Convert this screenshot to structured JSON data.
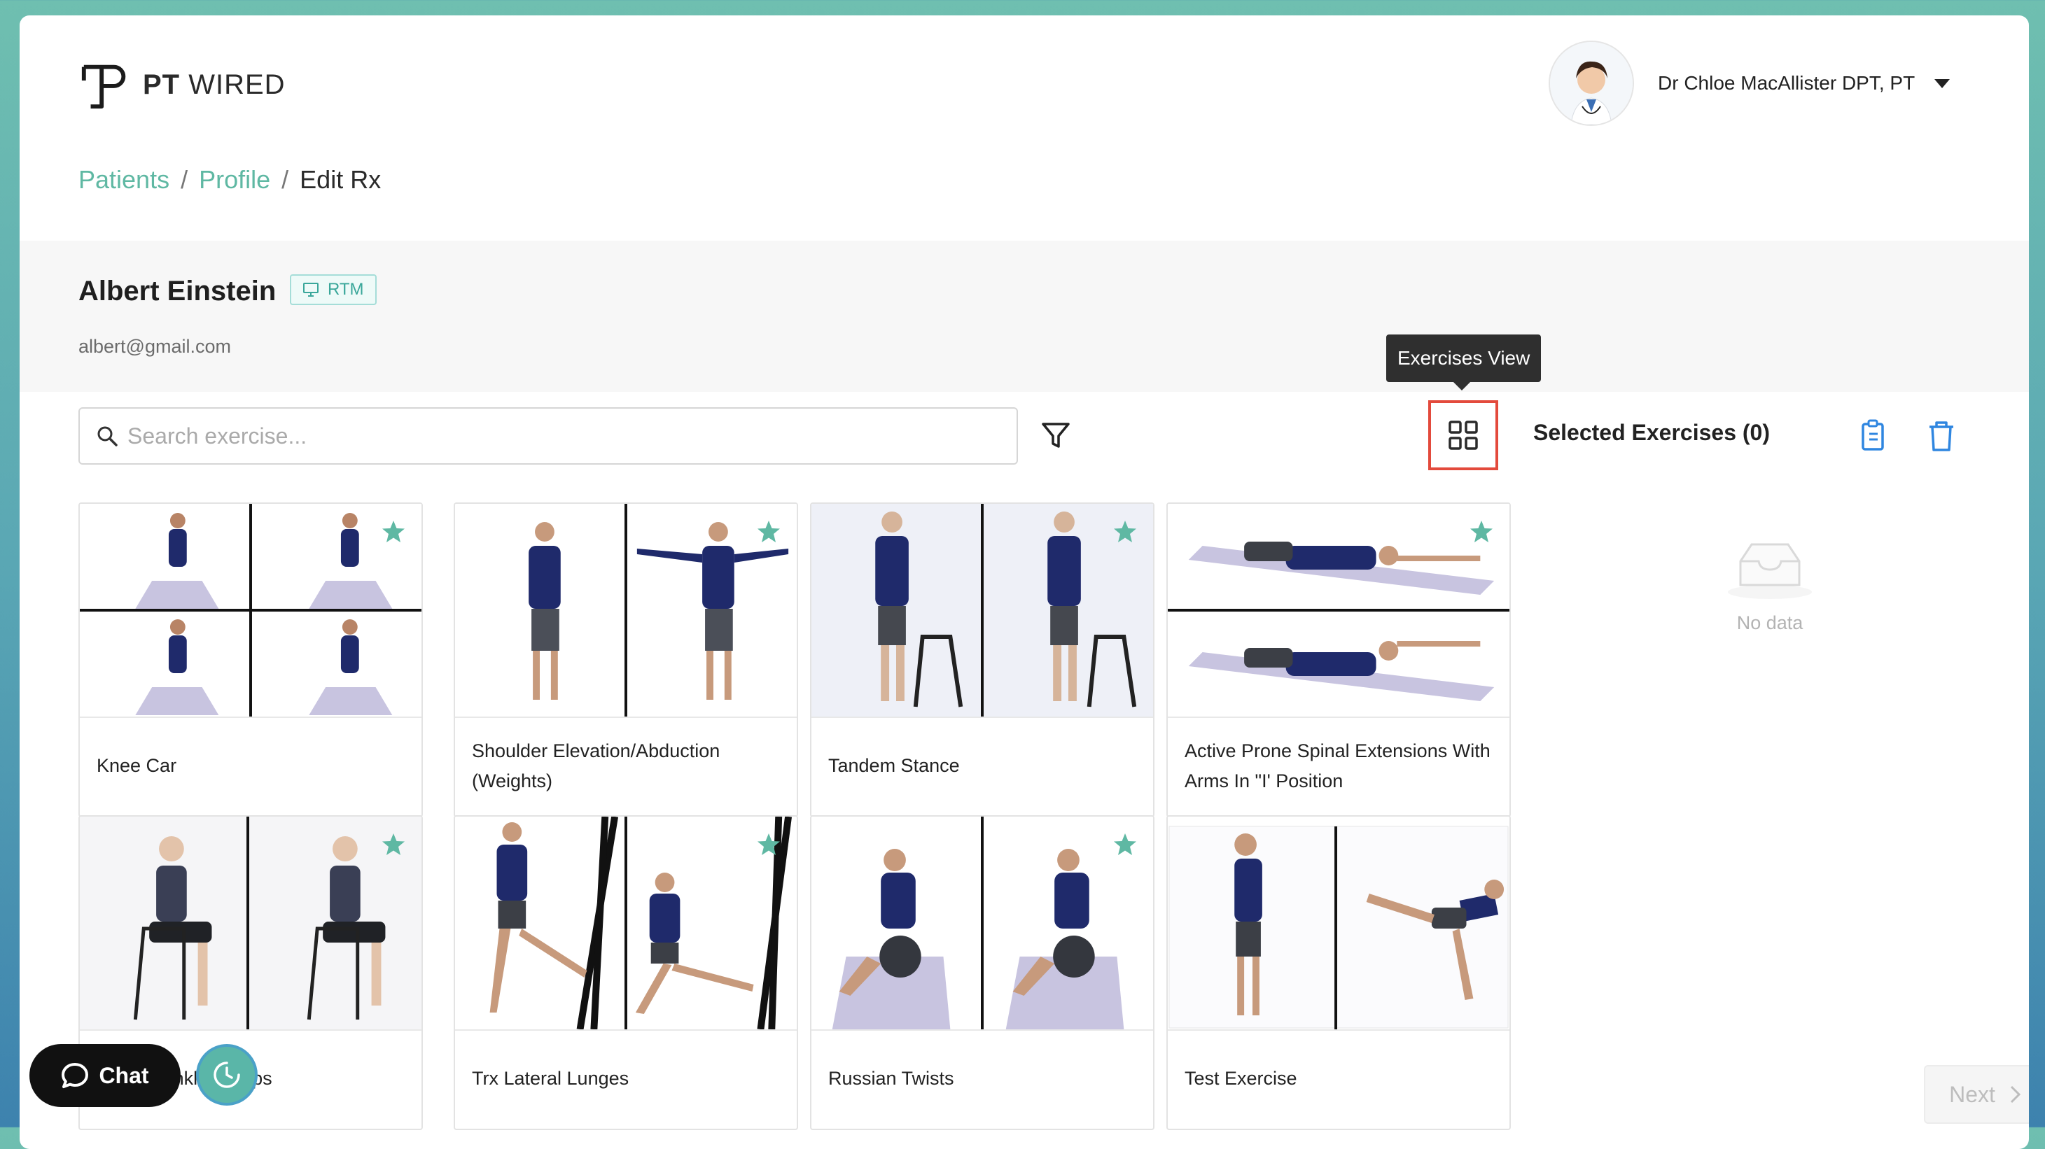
{
  "brand": {
    "name_bold": "PT",
    "name_rest": "WIRED"
  },
  "user": {
    "name": "Dr Chloe MacAllister DPT, PT"
  },
  "breadcrumb": {
    "items": [
      "Patients",
      "Profile"
    ],
    "separator": "/",
    "current": "Edit Rx"
  },
  "patient": {
    "name": "Albert Einstein",
    "badge": "RTM",
    "email": "albert@gmail.com"
  },
  "search": {
    "placeholder": "Search exercise..."
  },
  "toolbar": {
    "tooltip": "Exercises View"
  },
  "selected": {
    "title": "Selected Exercises (0)",
    "empty_text": "No data"
  },
  "exercises": [
    {
      "title": "Knee Car",
      "favorite": true
    },
    {
      "title": "Shoulder Elevation/Abduction (Weights)",
      "favorite": true
    },
    {
      "title": "Tandem Stance",
      "favorite": true
    },
    {
      "title": "Active Prone Spinal Extensions With Arms In \"I' Position",
      "favorite": true
    },
    {
      "title": "Seated Ankle Pumps",
      "favorite": true
    },
    {
      "title": "Trx Lateral Lunges",
      "favorite": true
    },
    {
      "title": "Russian Twists",
      "favorite": true
    },
    {
      "title": "Test Exercise",
      "favorite": false
    }
  ],
  "chat": {
    "label": "Chat"
  },
  "footer": {
    "next_label": "Next"
  },
  "colors": {
    "accent": "#5fb8a3",
    "highlight_border": "#e34a3c",
    "action_blue": "#2f86e0"
  }
}
